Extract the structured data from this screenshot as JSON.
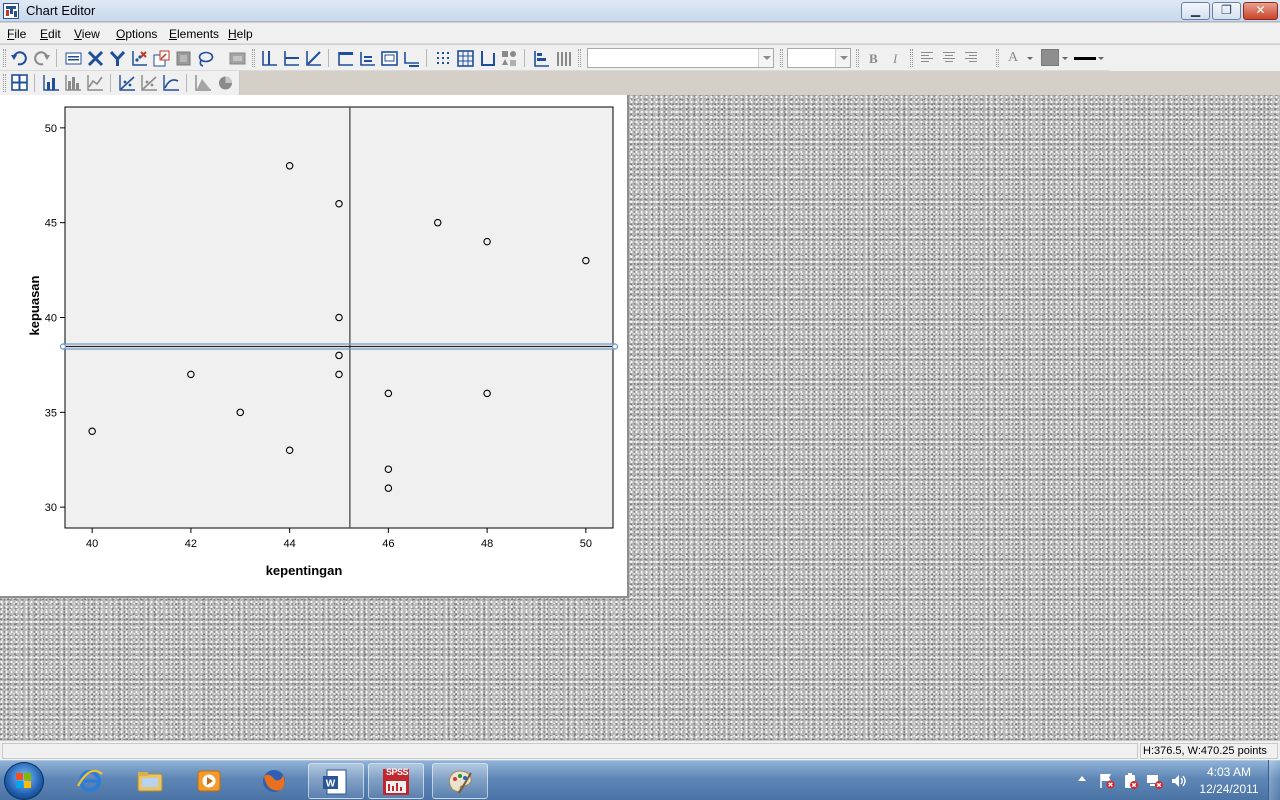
{
  "window": {
    "title": "Chart Editor",
    "minimize_label": "▁",
    "maximize_label": "❐",
    "close_label": "✕"
  },
  "menu": [
    {
      "label": "File"
    },
    {
      "label": "Edit"
    },
    {
      "label": "View"
    },
    {
      "label": "Options"
    },
    {
      "label": "Elements"
    },
    {
      "label": "Help"
    }
  ],
  "toolbar": {
    "font_name": "",
    "font_size": "",
    "bold_label": "B",
    "italic_label": "I",
    "text_color_label": "A",
    "icons": [
      "undo-icon",
      "redo-icon",
      "properties-icon",
      "x-axis-icon",
      "y-axis-icon",
      "rescale-icon",
      "data-id-icon",
      "zoom-icon",
      "lasso-icon",
      "comment-icon",
      "x-reference-line-icon",
      "y-reference-line-icon",
      "fit-line-icon",
      "title-icon",
      "annotation-icon",
      "text-box-icon",
      "footnote-icon",
      "grid-lines-icon",
      "grid-icon",
      "axis-icon",
      "marker-icon",
      "sort-bars-icon",
      "bars-icon",
      "chart-template-icon",
      "bar-chart-icon",
      "histogram-icon",
      "line-chart-icon",
      "scatter-icon",
      "scatter-matrix-icon",
      "line-icon",
      "area-icon",
      "pie-icon"
    ]
  },
  "chart_data": {
    "type": "scatter",
    "title": "",
    "xlabel": "kepentingan",
    "ylabel": "kepuasan",
    "xlim": [
      39.45,
      50.55
    ],
    "ylim": [
      28.9,
      51.1
    ],
    "xticks": [
      "40",
      "42",
      "44",
      "46",
      "48",
      "50"
    ],
    "xtick_values": [
      40,
      42,
      44,
      46,
      48,
      50
    ],
    "yticks": [
      "30",
      "35",
      "40",
      "45",
      "50"
    ],
    "ytick_values": [
      30,
      35,
      40,
      45,
      50
    ],
    "grid": false,
    "reference_lines": [
      {
        "orientation": "vertical",
        "value": 45.22,
        "color": "#555555"
      },
      {
        "orientation": "horizontal",
        "value": 38.47,
        "color": "#6d98c6",
        "selected": true
      }
    ],
    "series": [
      {
        "points": [
          [
            40,
            34
          ],
          [
            42,
            37
          ],
          [
            43,
            35
          ],
          [
            44,
            48
          ],
          [
            44,
            33
          ],
          [
            45,
            46
          ],
          [
            45,
            40
          ],
          [
            45,
            38
          ],
          [
            45,
            37
          ],
          [
            46,
            36
          ],
          [
            46,
            32
          ],
          [
            46,
            31
          ],
          [
            47,
            45
          ],
          [
            48,
            44
          ],
          [
            48,
            36
          ],
          [
            50,
            43
          ]
        ]
      }
    ],
    "colors": {
      "plot_background": "#f0f0f0",
      "marker_stroke": "#000000",
      "selection": "#6d98c6"
    }
  },
  "status": {
    "left_text": "",
    "dimensions": "H:376.5, W:470.25 points"
  },
  "taskbar": {
    "apps": [
      {
        "name": "internet-explorer",
        "running": false
      },
      {
        "name": "windows-explorer",
        "running": false
      },
      {
        "name": "media-player",
        "running": false
      },
      {
        "name": "firefox",
        "running": false
      },
      {
        "name": "microsoft-word",
        "running": true
      },
      {
        "name": "spss",
        "running": true,
        "label": "SPSS"
      },
      {
        "name": "paint",
        "running": true
      }
    ],
    "time": "4:03 AM",
    "date": "12/24/2011"
  }
}
